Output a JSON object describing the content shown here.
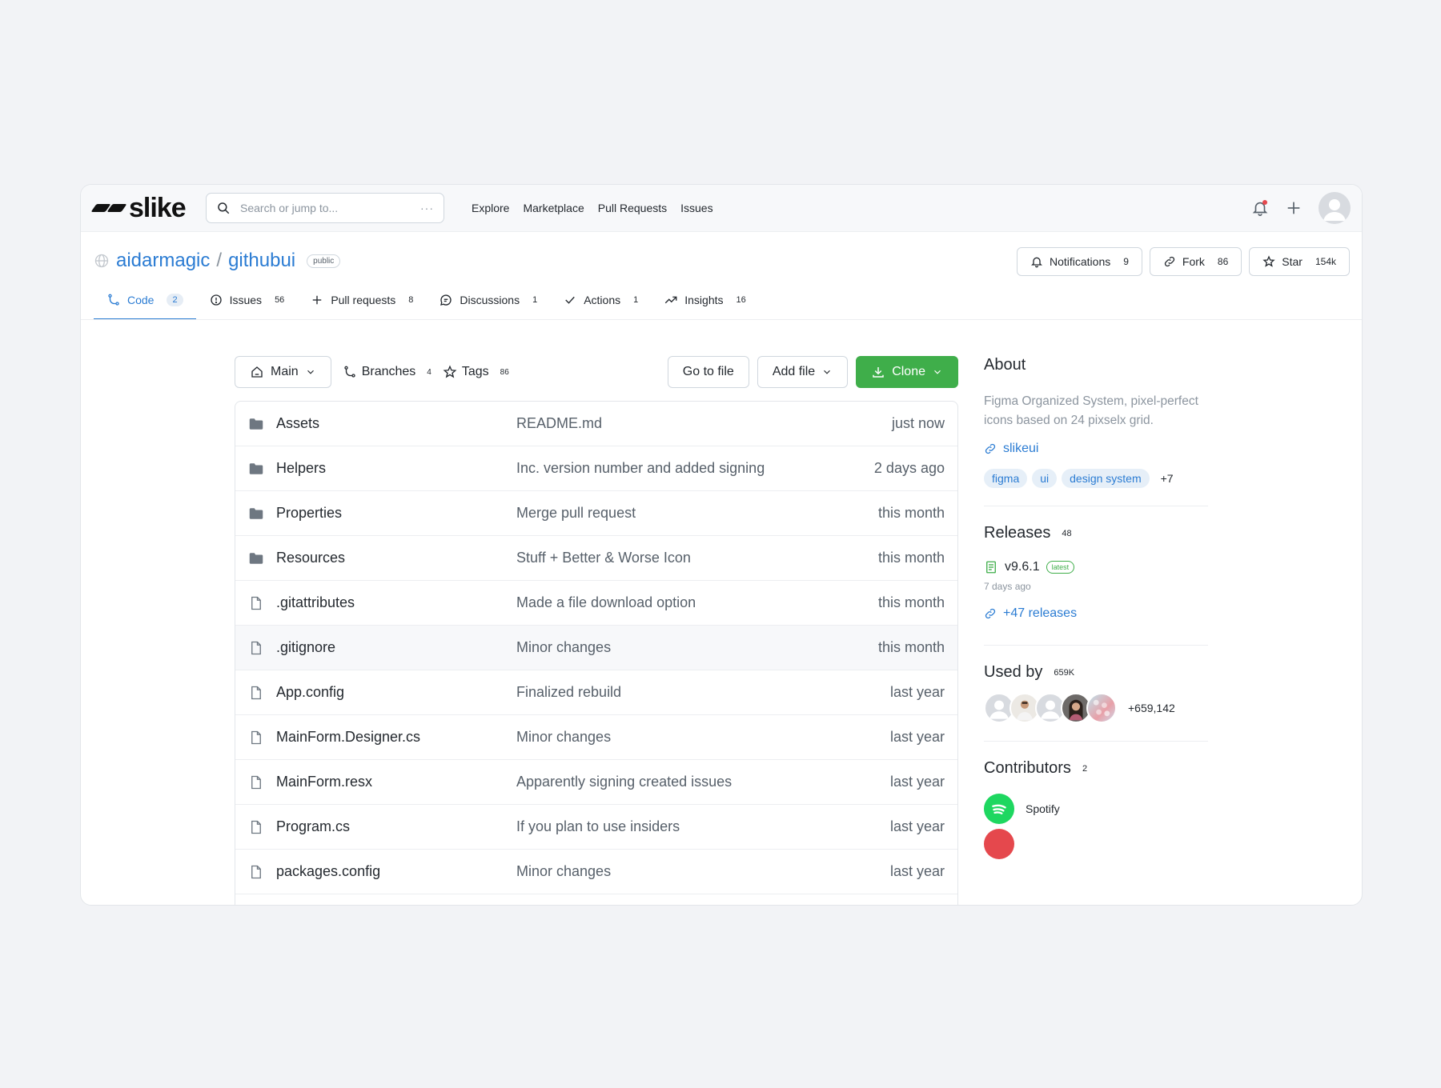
{
  "brand": {
    "name": "slike"
  },
  "search": {
    "placeholder": "Search or jump to...",
    "hint": "···"
  },
  "top_nav": [
    "Explore",
    "Marketplace",
    "Pull Requests",
    "Issues"
  ],
  "repo": {
    "owner": "aidarmagic",
    "separator": "/",
    "name": "githubui",
    "visibility": "public"
  },
  "repo_actions": {
    "notifications": {
      "label": "Notifications",
      "count": "9"
    },
    "fork": {
      "label": "Fork",
      "count": "86"
    },
    "star": {
      "label": "Star",
      "count": "154k"
    }
  },
  "tabs": [
    {
      "label": "Code",
      "count": "2",
      "icon": "branch-icon",
      "active": true
    },
    {
      "label": "Issues",
      "count": "56",
      "icon": "issue-icon"
    },
    {
      "label": "Pull requests",
      "count": "8",
      "icon": "plus-icon"
    },
    {
      "label": "Discussions",
      "count": "1",
      "icon": "chat-icon"
    },
    {
      "label": "Actions",
      "count": "1",
      "icon": "check-icon"
    },
    {
      "label": "Insights",
      "count": "16",
      "icon": "trend-icon"
    }
  ],
  "toolbar": {
    "branch": "Main",
    "branches": {
      "label": "Branches",
      "count": "4"
    },
    "tags": {
      "label": "Tags",
      "count": "86"
    },
    "go_to_file": "Go to file",
    "add_file": "Add file",
    "clone": "Clone"
  },
  "files": [
    {
      "name": "Assets",
      "type": "folder",
      "message": "README.md",
      "time": "just now"
    },
    {
      "name": "Helpers",
      "type": "folder",
      "message": "Inc. version number and added signing",
      "time": "2 days ago"
    },
    {
      "name": "Properties",
      "type": "folder",
      "message": "Merge pull request",
      "time": "this month"
    },
    {
      "name": "Resources",
      "type": "folder",
      "message": "Stuff + Better & Worse Icon",
      "time": "this month"
    },
    {
      "name": ".gitattributes",
      "type": "file",
      "message": "Made a file download option",
      "time": "this month"
    },
    {
      "name": ".gitignore",
      "type": "file",
      "message": "Minor changes",
      "time": "this month"
    },
    {
      "name": "App.config",
      "type": "file",
      "message": "Finalized rebuild",
      "time": "last year"
    },
    {
      "name": "MainForm.Designer.cs",
      "type": "file",
      "message": "Minor changes",
      "time": "last year"
    },
    {
      "name": "MainForm.resx",
      "type": "file",
      "message": "Apparently signing created issues",
      "time": "last year"
    },
    {
      "name": "Program.cs",
      "type": "file",
      "message": "If you plan to use insiders",
      "time": "last year"
    },
    {
      "name": "packages.config",
      "type": "file",
      "message": "Minor changes",
      "time": "last year"
    }
  ],
  "about": {
    "title": "About",
    "description": "Figma Organized System, pixel-perfect icons based on 24 pixselx grid.",
    "link": "slikeui",
    "topics": [
      "figma",
      "ui",
      "design system"
    ],
    "topics_more": "+7"
  },
  "releases": {
    "title": "Releases",
    "count": "48",
    "latest_version": "v9.6.1",
    "latest_badge": "latest",
    "date": "7 days ago",
    "more_link": "+47 releases"
  },
  "used_by": {
    "title": "Used by",
    "count": "659K",
    "extra": "+659,142"
  },
  "contributors": {
    "title": "Contributors",
    "count": "2",
    "items": [
      {
        "name": "Spotify"
      }
    ]
  },
  "colors": {
    "accent": "#2b7cd3",
    "green": "#3fae4a",
    "spotify": "#1ed760",
    "alert": "#e5484d"
  }
}
